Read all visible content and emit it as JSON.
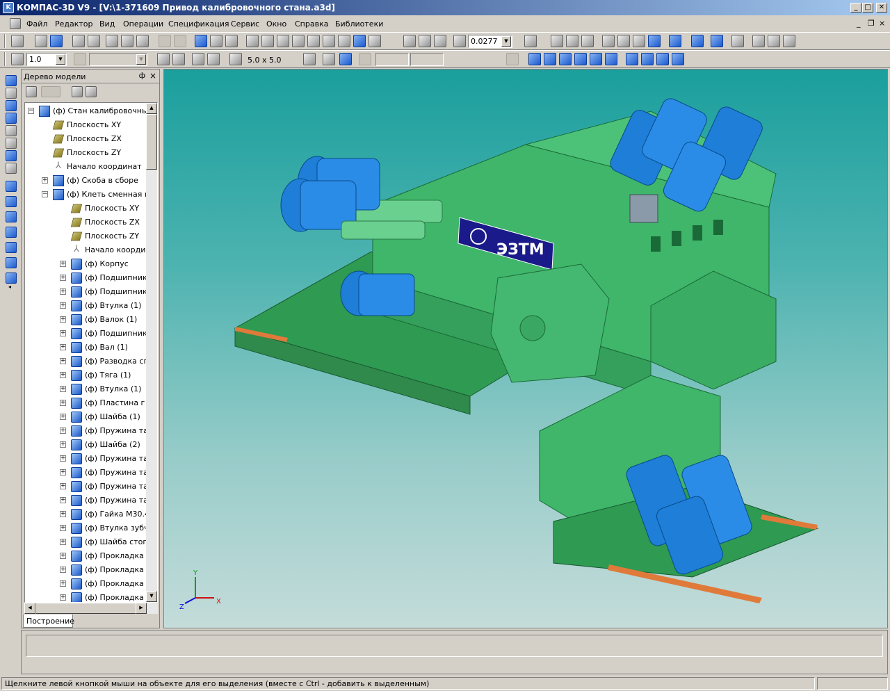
{
  "window": {
    "title": "КОМПАС-3D V9 - [V:\\1-371609 Привод калибровочного стана.a3d]",
    "app_icon": "kompas-logo-icon",
    "buttons": {
      "minimize": "_",
      "maximize": "□",
      "close": "✕"
    }
  },
  "menu": {
    "items": [
      {
        "label": "Файл"
      },
      {
        "label": "Редактор"
      },
      {
        "label": "Вид"
      },
      {
        "label": "Операции"
      },
      {
        "label": "Спецификация"
      },
      {
        "label": "Сервис"
      },
      {
        "label": "Окно"
      },
      {
        "label": "Справка"
      },
      {
        "label": "Библиотеки"
      }
    ],
    "mdi_minimize": "_",
    "mdi_restore": "❐",
    "mdi_close": "×"
  },
  "toolbar1": {
    "zoom_value": "0.0277",
    "icons": [
      "new-icon",
      "open-icon",
      "save-icon",
      "print-icon",
      "preview-icon",
      "cut-icon",
      "copy-icon",
      "paste-icon",
      "undo-icon",
      "redo-icon",
      "properties-icon",
      "tree-icon",
      "variables-icon",
      "zoom-in-icon",
      "zoom-icon",
      "zoom-out-icon",
      "pan-icon",
      "rotate-icon",
      "orientation-icon",
      "shaded-icon",
      "wireframe-icon"
    ]
  },
  "toolbar2": {
    "step_value": "1.0",
    "grid_value": "5.0 x 5.0",
    "layer_value": ""
  },
  "tree_panel": {
    "header": "Дерево модели",
    "pin": "ф",
    "close": "×",
    "tab_label": "Построение",
    "rows": [
      {
        "label": "(ф) Стан калибровочный",
        "icon": "assembly-icon",
        "level": 0,
        "expander": "−"
      },
      {
        "label": "Плоскость XY",
        "icon": "plane-icon",
        "level": 1,
        "expander": ""
      },
      {
        "label": "Плоскость ZX",
        "icon": "plane-icon",
        "level": 1,
        "expander": ""
      },
      {
        "label": "Плоскость ZY",
        "icon": "plane-icon",
        "level": 1,
        "expander": ""
      },
      {
        "label": "Начало координат",
        "icon": "axis-origin-icon",
        "level": 1,
        "expander": ""
      },
      {
        "label": "(ф) Скоба в сборе",
        "icon": "assembly-icon",
        "level": 1,
        "expander": "+"
      },
      {
        "label": "(ф) Клеть сменная к",
        "icon": "assembly-icon",
        "level": 1,
        "expander": "−"
      },
      {
        "label": "Плоскость XY",
        "icon": "plane-icon",
        "level": 2,
        "expander": ""
      },
      {
        "label": "Плоскость ZX",
        "icon": "plane-icon",
        "level": 2,
        "expander": ""
      },
      {
        "label": "Плоскость ZY",
        "icon": "plane-icon",
        "level": 2,
        "expander": ""
      },
      {
        "label": "Начало коорди",
        "icon": "axis-origin-icon",
        "level": 2,
        "expander": ""
      },
      {
        "label": "(ф) Корпус",
        "icon": "part-icon",
        "level": 2,
        "expander": "+"
      },
      {
        "label": "(ф) Подшипник",
        "icon": "part-icon",
        "level": 2,
        "expander": "+"
      },
      {
        "label": "(ф) Подшипник",
        "icon": "part-icon",
        "level": 2,
        "expander": "+"
      },
      {
        "label": "(ф) Втулка (1)",
        "icon": "part-icon",
        "level": 2,
        "expander": "+"
      },
      {
        "label": "(ф) Валок (1)",
        "icon": "part-icon",
        "level": 2,
        "expander": "+"
      },
      {
        "label": "(ф) Подшипник",
        "icon": "part-icon",
        "level": 2,
        "expander": "+"
      },
      {
        "label": "(ф) Вал (1)",
        "icon": "part-icon",
        "level": 2,
        "expander": "+"
      },
      {
        "label": "(ф) Разводка сп",
        "icon": "part-icon",
        "level": 2,
        "expander": "+"
      },
      {
        "label": "(ф) Тяга (1)",
        "icon": "part-icon",
        "level": 2,
        "expander": "+"
      },
      {
        "label": "(ф) Втулка (1)",
        "icon": "part-icon",
        "level": 2,
        "expander": "+"
      },
      {
        "label": "(ф)  Пластина г",
        "icon": "part-icon",
        "level": 2,
        "expander": "+"
      },
      {
        "label": "(ф) Шайба (1)",
        "icon": "part-icon",
        "level": 2,
        "expander": "+"
      },
      {
        "label": "(ф) Пружина тар",
        "icon": "part-icon",
        "level": 2,
        "expander": "+"
      },
      {
        "label": "(ф) Шайба (2)",
        "icon": "part-icon",
        "level": 2,
        "expander": "+"
      },
      {
        "label": "(ф) Пружина тар",
        "icon": "part-icon",
        "level": 2,
        "expander": "+"
      },
      {
        "label": "(ф) Пружина тар",
        "icon": "part-icon",
        "level": 2,
        "expander": "+"
      },
      {
        "label": "(ф) Пружина тар",
        "icon": "part-icon",
        "level": 2,
        "expander": "+"
      },
      {
        "label": "(ф) Пружина тар",
        "icon": "part-icon",
        "level": 2,
        "expander": "+"
      },
      {
        "label": "(ф) Гайка М30.4",
        "icon": "part-icon",
        "level": 2,
        "expander": "+"
      },
      {
        "label": "(ф) Втулка зубч",
        "icon": "part-icon",
        "level": 2,
        "expander": "+"
      },
      {
        "label": "(ф) Шайба стопо",
        "icon": "part-icon",
        "level": 2,
        "expander": "+"
      },
      {
        "label": "(ф) Прокладка (",
        "icon": "part-icon",
        "level": 2,
        "expander": "+"
      },
      {
        "label": "(ф) Прокладка (",
        "icon": "part-icon",
        "level": 2,
        "expander": "+"
      },
      {
        "label": "(ф) Прокладка (",
        "icon": "part-icon",
        "level": 2,
        "expander": "+"
      },
      {
        "label": "(ф) Прокладка (",
        "icon": "part-icon",
        "level": 2,
        "expander": "+"
      }
    ]
  },
  "viewport": {
    "logo_text": "ЭЗТМ",
    "axis_x": "X",
    "axis_y": "Y",
    "axis_z": "Z",
    "background_top": "#1a9f9d",
    "background_bottom": "#c4dcda",
    "model_color": "#3fb66a",
    "motor_color": "#1e7ed8"
  },
  "status": {
    "text": "Щелкните левой кнопкой мыши на объекте для его выделения (вместе с Ctrl - добавить к выделенным)"
  }
}
